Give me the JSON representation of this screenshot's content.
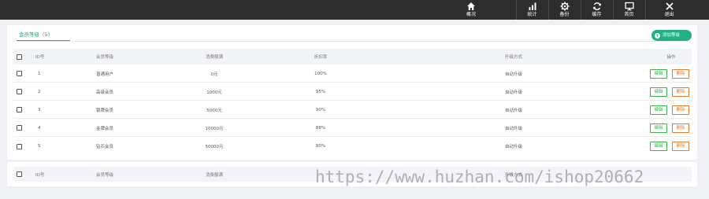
{
  "topnav": [
    {
      "icon": "home-icon",
      "label": "概况"
    },
    {
      "icon": "stats-icon",
      "label": "统计"
    },
    {
      "icon": "gear-icon",
      "label": "备份"
    },
    {
      "icon": "refresh-icon",
      "label": "缓存"
    },
    {
      "icon": "monitor-icon",
      "label": "首页"
    },
    {
      "icon": "close-icon",
      "label": "退出"
    }
  ],
  "tab": {
    "label": "会员等级（5）"
  },
  "add_button": {
    "label": "添加等级"
  },
  "table": {
    "headers": {
      "id": "ID号",
      "level": "会员等级",
      "amount": "消费额满",
      "discount": "折扣率",
      "upgrade": "升级方式",
      "ops": "操作"
    },
    "rows": [
      {
        "id": "1",
        "level": "普通用户",
        "amount": "0元",
        "discount": "100%",
        "upgrade": "自动升级"
      },
      {
        "id": "2",
        "level": "高级会员",
        "amount": "1000元",
        "discount": "95%",
        "upgrade": "自动升级"
      },
      {
        "id": "3",
        "level": "银牌会员",
        "amount": "5000元",
        "discount": "90%",
        "upgrade": "自动升级"
      },
      {
        "id": "4",
        "level": "金牌会员",
        "amount": "10000元",
        "discount": "88%",
        "upgrade": "自动升级"
      },
      {
        "id": "5",
        "level": "钻石会员",
        "amount": "50000元",
        "discount": "80%",
        "upgrade": "自动升级"
      }
    ],
    "edit_label": "编辑",
    "delete_label": "删除"
  },
  "footer_table": {
    "headers": {
      "id": "ID号",
      "level": "会员等级",
      "amount": "消费额满",
      "upgrade": "升级方式"
    }
  },
  "watermark": "https://www.huzhan.com/ishop20662"
}
